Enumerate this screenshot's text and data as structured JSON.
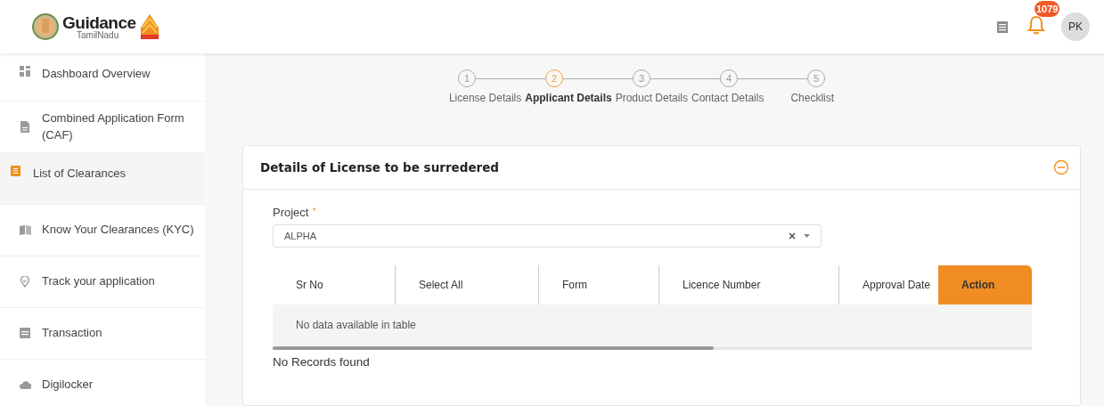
{
  "header": {
    "logo": {
      "title": "Guidance",
      "subtitle": "TamilNadu"
    },
    "notifications": {
      "count": "1079"
    },
    "avatar": "PK"
  },
  "sidebar": {
    "items": [
      {
        "kind": "dashboard",
        "label": "Dashboard Overview",
        "selected": false
      },
      {
        "kind": "document",
        "label": "Combined Application Form (CAF)",
        "selected": false
      },
      {
        "kind": "list",
        "label": "List of Clearances",
        "selected": true
      },
      {
        "kind": "book",
        "label": "Know Your Clearances (KYC)",
        "selected": false
      },
      {
        "kind": "pin",
        "label": "Track your application",
        "selected": false
      },
      {
        "kind": "card",
        "label": "Transaction",
        "selected": false
      },
      {
        "kind": "cloud",
        "label": "Digilocker",
        "selected": false
      }
    ]
  },
  "stepper": [
    {
      "number": "1",
      "label": "License Details",
      "selected": false
    },
    {
      "number": "2",
      "label": "Applicant Details",
      "selected": true
    },
    {
      "number": "3",
      "label": "Product Details",
      "selected": false
    },
    {
      "number": "4",
      "label": "Contact Details",
      "selected": false
    },
    {
      "number": "5",
      "label": "Checklist",
      "selected": false
    }
  ],
  "card": {
    "title": "Details of License to be surredered",
    "expanded": true,
    "project": {
      "label": "Project",
      "required_mark": "*",
      "value": "ALPHA"
    },
    "table": {
      "columns": [
        {
          "label": "Sr No",
          "kind": "plain"
        },
        {
          "label": "Select All",
          "kind": "plain"
        },
        {
          "label": "Form",
          "kind": "plain"
        },
        {
          "label": "Licence Number",
          "kind": "plain"
        },
        {
          "label": "Approval Date",
          "kind": "plain"
        },
        {
          "label": "Action",
          "kind": "accent"
        }
      ],
      "empty_message": "No data available in table"
    },
    "footer": "No Records found"
  }
}
